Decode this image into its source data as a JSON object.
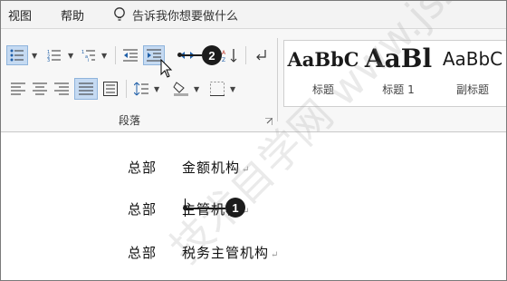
{
  "menu": {
    "view": "视图",
    "help": "帮助",
    "tell_me": "告诉我你想要做什么"
  },
  "ribbon": {
    "group_label": "段落",
    "styles": [
      {
        "preview": "AaBbC",
        "name": "标题"
      },
      {
        "preview": "AaBl",
        "name": "标题 1"
      },
      {
        "preview": "AaBbC",
        "name": "副标题"
      }
    ],
    "icons": [
      "bullets-icon",
      "numbering-icon",
      "multilevel-list-icon",
      "decrease-indent-icon",
      "increase-indent-icon",
      "chinese-layout-icon",
      "sort-icon",
      "show-marks-icon",
      "align-left-icon",
      "center-icon",
      "align-right-icon",
      "justify-icon",
      "distributed-icon",
      "line-spacing-icon",
      "shading-icon",
      "borders-icon"
    ]
  },
  "document": {
    "lines": [
      {
        "dept": "总部",
        "text": "金额机构"
      },
      {
        "dept": "总部",
        "text": "主管机构"
      },
      {
        "dept": "总部",
        "text": "税务主管机构"
      }
    ],
    "para_mark": "↵"
  },
  "callouts": {
    "first": "1",
    "second": "2"
  },
  "watermark": "技术自学网 www.jszx.cc",
  "colors": {
    "selected": "#c5daf2",
    "ribbon_bg": "#f7f7f7",
    "callout": "#1c1c1c"
  }
}
